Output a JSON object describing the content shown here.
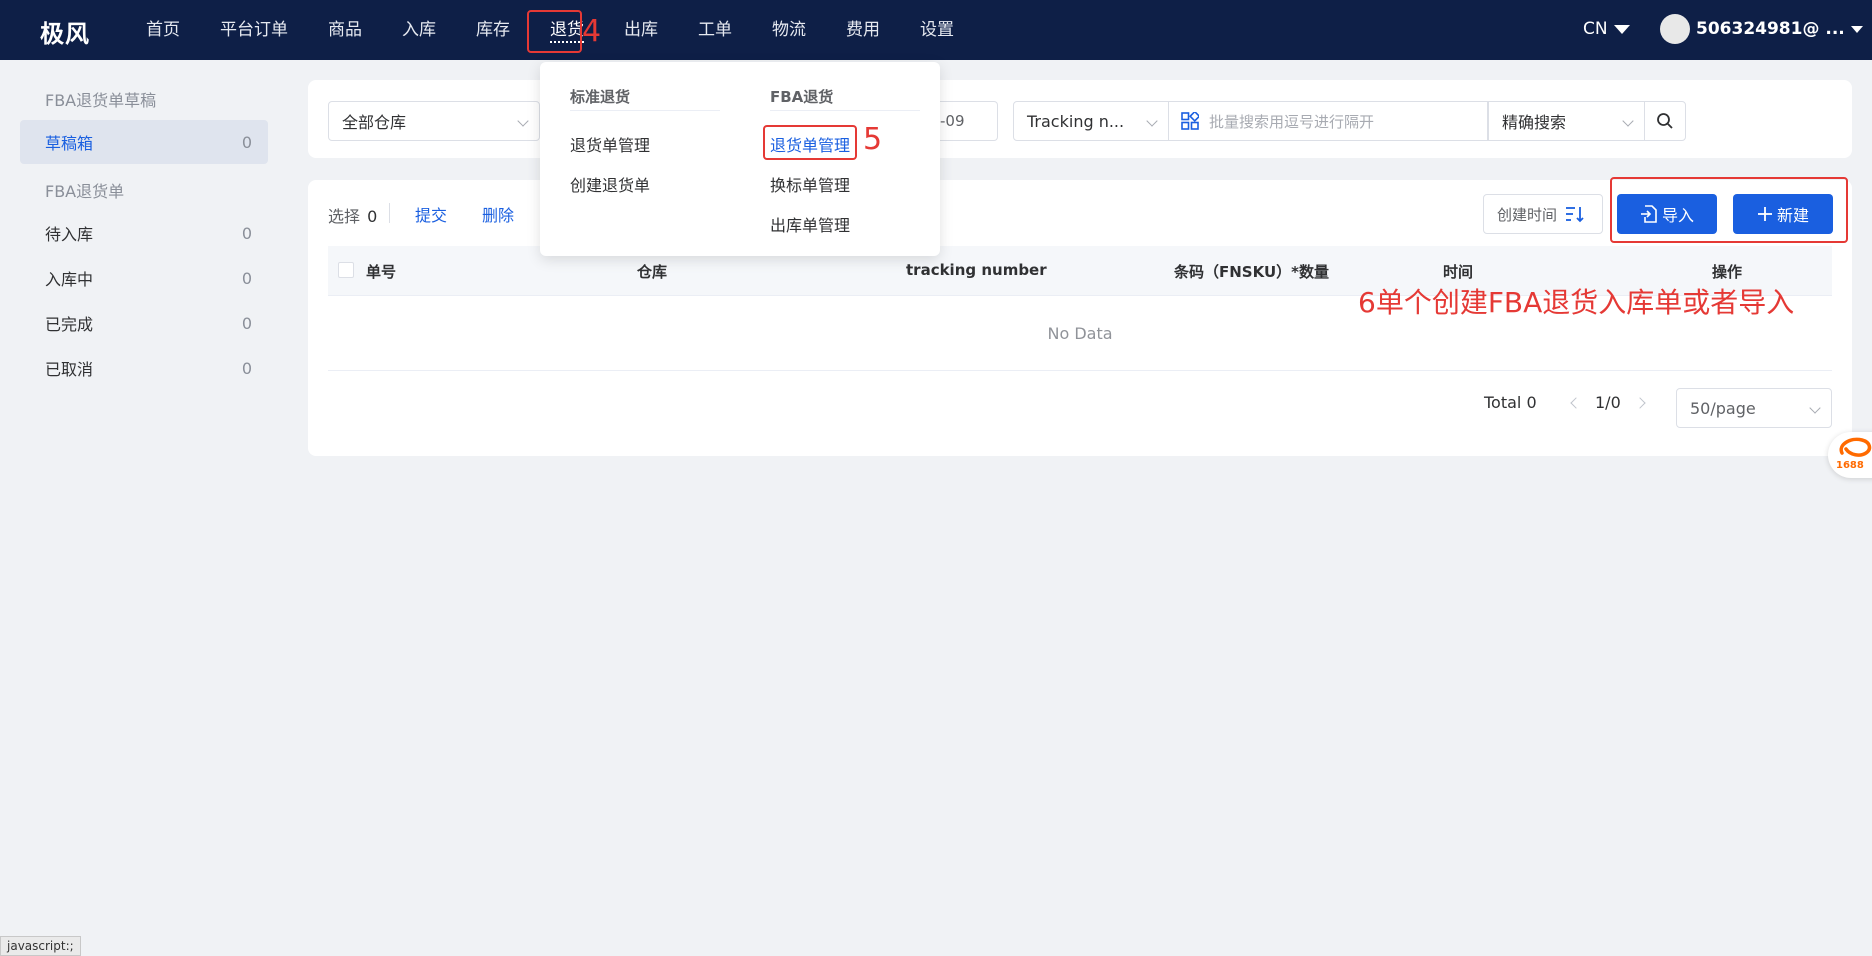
{
  "nav": {
    "brand": "极风",
    "items": [
      "首页",
      "平台订单",
      "商品",
      "入库",
      "库存",
      "退货",
      "出库",
      "工单",
      "物流",
      "费用",
      "设置"
    ],
    "active": "退货",
    "lang": "CN",
    "user": "506324981@ ..."
  },
  "sidebar": {
    "group1": "FBA退货单草稿",
    "draft_label": "草稿箱",
    "draft_count": "0",
    "group2": "FBA退货单",
    "items": [
      {
        "label": "待入库",
        "count": "0"
      },
      {
        "label": "入库中",
        "count": "0"
      },
      {
        "label": "已完成",
        "count": "0"
      },
      {
        "label": "已取消",
        "count": "0"
      }
    ]
  },
  "filters": {
    "warehouse": "全部仓库",
    "date_fragment": "-09",
    "tracking_type": "Tracking n...",
    "batch_placeholder": "批量搜索用逗号进行隔开",
    "search_mode": "精确搜索"
  },
  "toolbar": {
    "select_label": "选择",
    "select_count": "0",
    "submit": "提交",
    "delete": "删除",
    "sort_label": "创建时间",
    "import": "导入",
    "new": "新建"
  },
  "table": {
    "columns": [
      "单号",
      "仓库",
      "tracking number",
      "条码（FNSKU）*数量",
      "时间",
      "操作"
    ],
    "empty": "No Data"
  },
  "pager": {
    "total": "Total 0",
    "page": "1/0",
    "size": "50/page"
  },
  "dropdown": {
    "col1_title": "标准退货",
    "col1_items": [
      "退货单管理",
      "创建退货单"
    ],
    "col2_title": "FBA退货",
    "col2_items": [
      "退货单管理",
      "换标单管理",
      "出库单管理"
    ]
  },
  "annotations": {
    "step4": "4",
    "step5": "5",
    "step6": "6单个创建FBA退货入库单或者导入"
  },
  "badge": "1688",
  "statusbar": "javascript:;",
  "colors": {
    "nav_bg": "#0e1f47",
    "primary": "#1a5fe0",
    "annotation": "#e53935"
  }
}
